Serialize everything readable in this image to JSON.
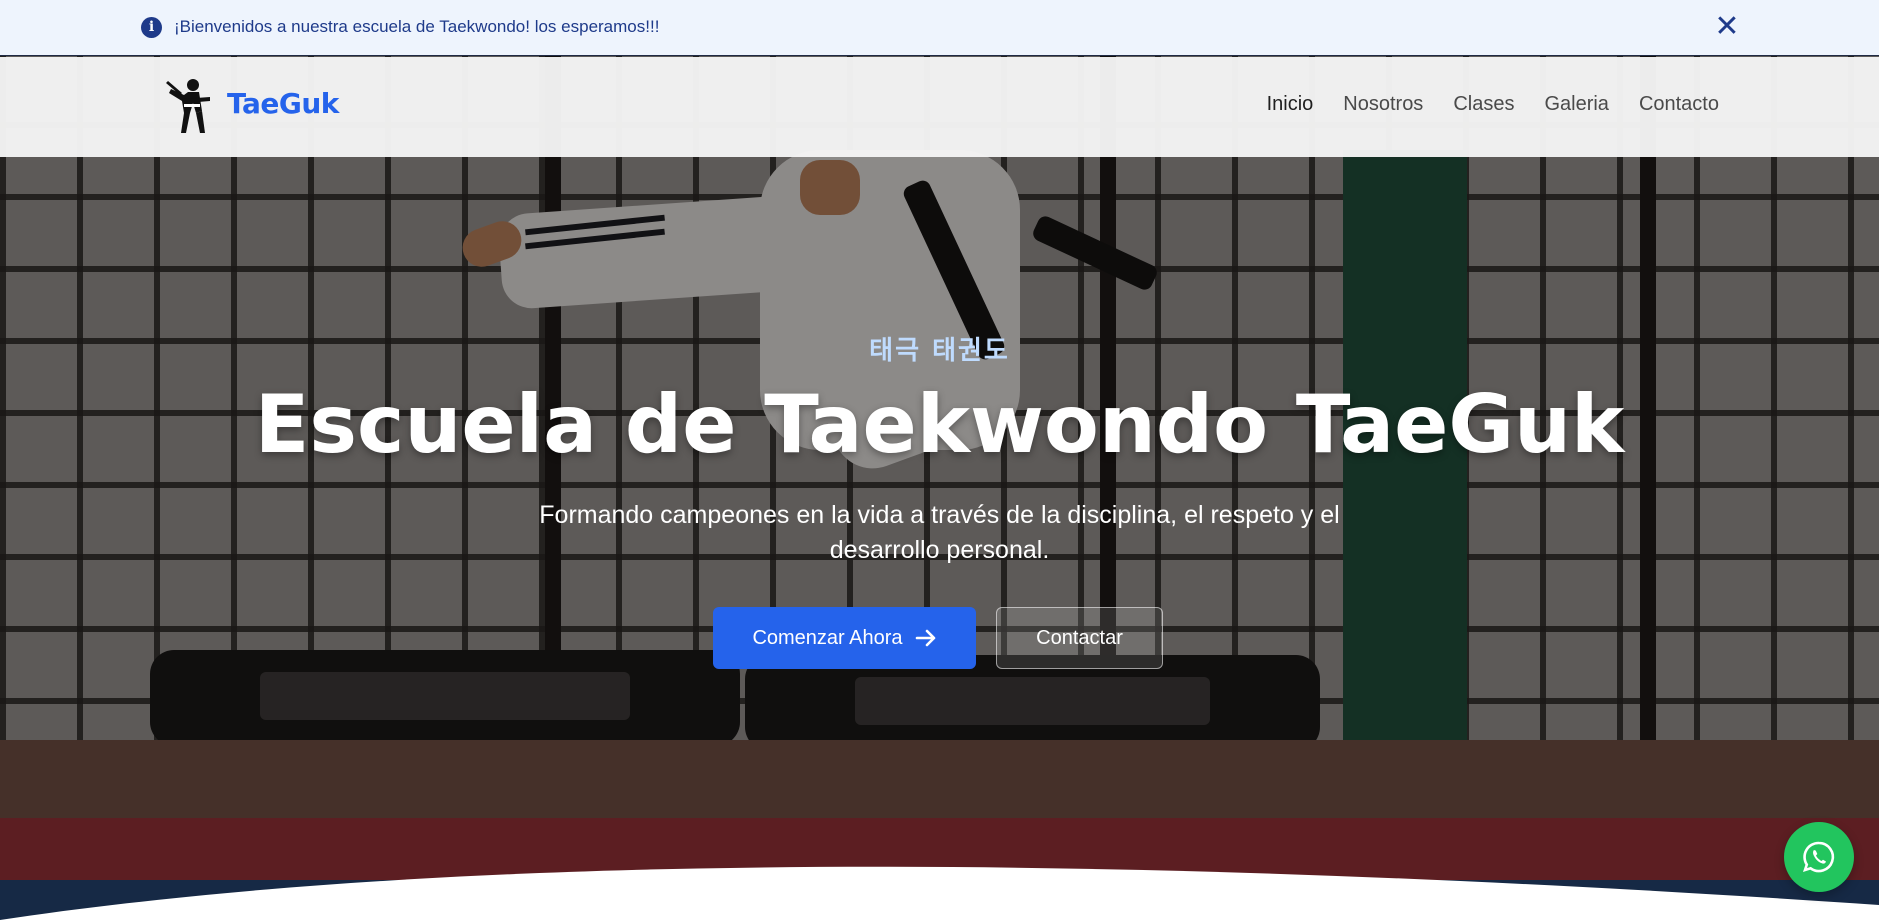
{
  "announcement": {
    "message": "¡Bienvenidos a nuestra escuela de Taekwondo! los esperamos!!!",
    "icon": "info-icon",
    "close_glyph": "✕"
  },
  "navbar": {
    "brand": "TaeGuk",
    "logo_icon": "taekwondo-kicker-icon",
    "links": [
      "Inicio",
      "Nosotros",
      "Clases",
      "Galeria",
      "Contacto"
    ]
  },
  "hero": {
    "korean_title": "태극 태권도",
    "title": "Escuela de Taekwondo TaeGuk",
    "subtitle": "Formando campeones en la vida a través de la disciplina, el respeto y el desarrollo personal.",
    "primary_button": "Comenzar Ahora",
    "primary_button_icon": "arrow-right-icon",
    "secondary_button": "Contactar"
  },
  "floating": {
    "whatsapp_icon": "whatsapp-icon"
  },
  "colors": {
    "accent": "#2563eb",
    "announcement_bg": "#eef4fd",
    "announcement_text": "#1e3a8a",
    "whatsapp": "#22c55e",
    "korean_text": "#bfdbfe"
  }
}
